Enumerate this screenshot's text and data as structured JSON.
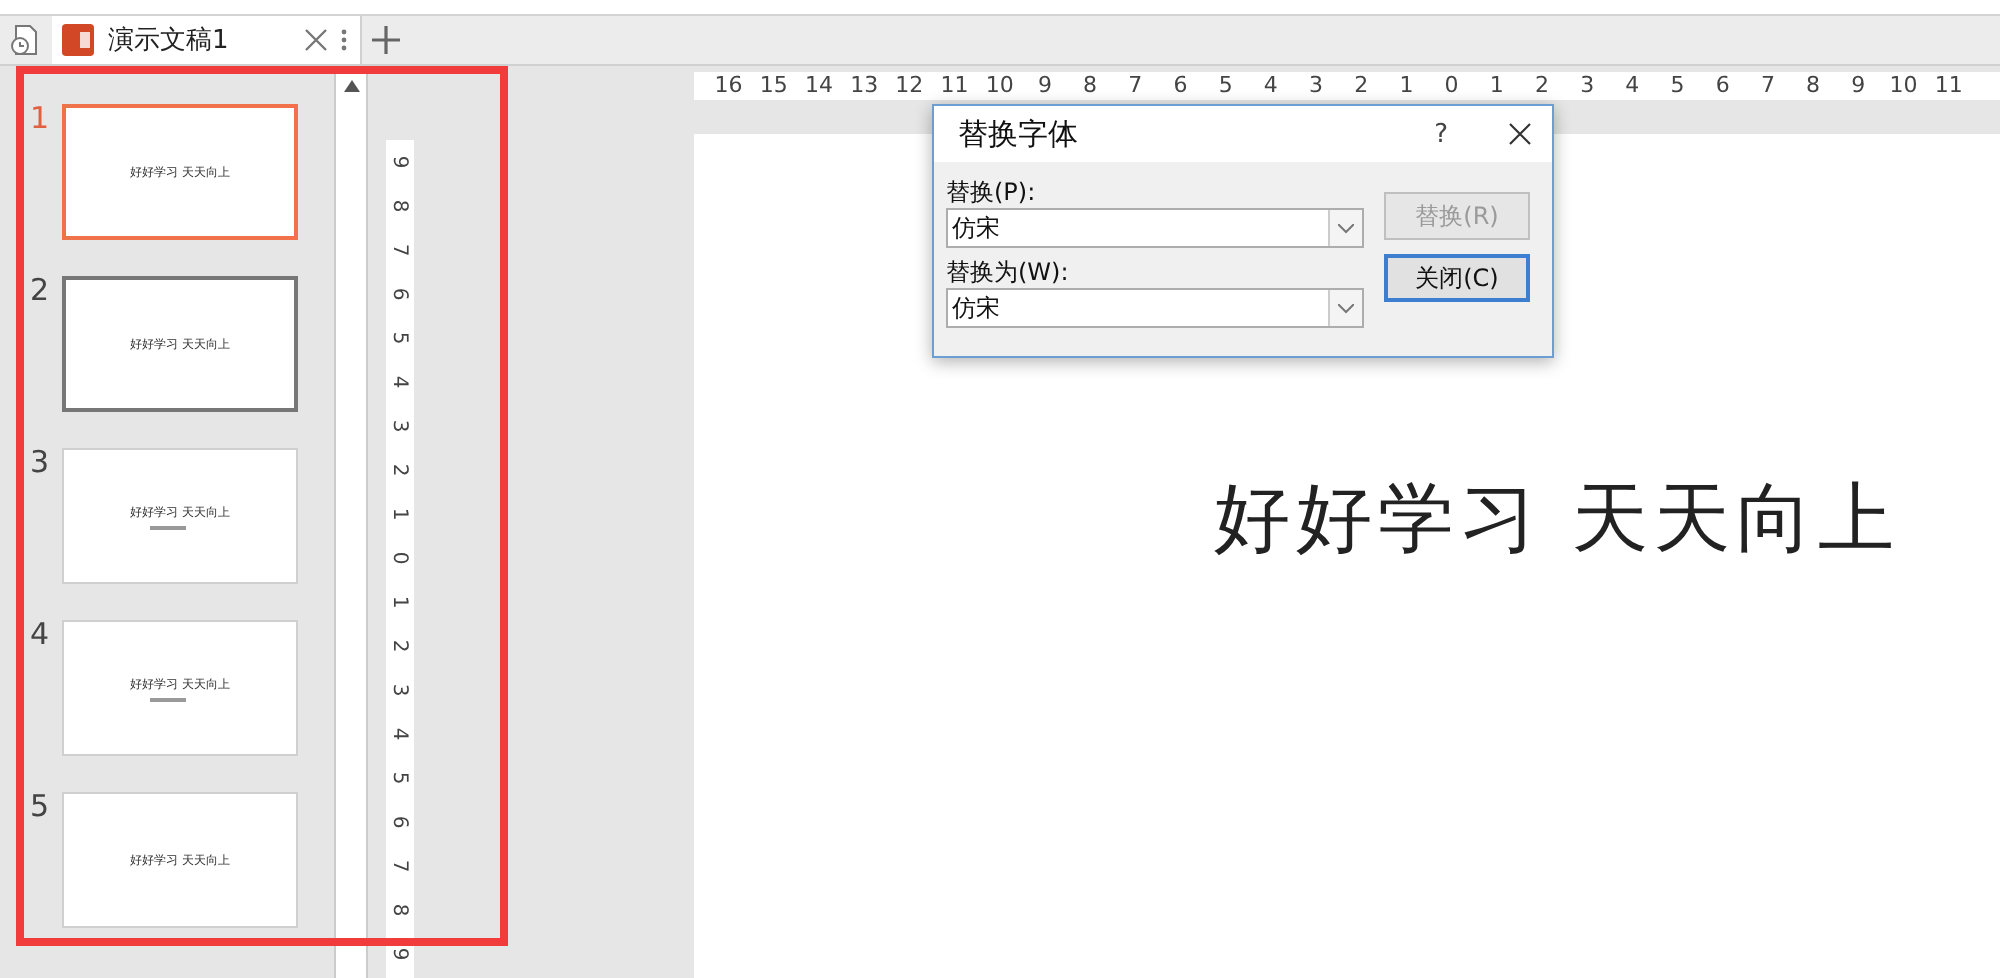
{
  "tabs": [
    {
      "label": "演示文稿1",
      "selected": true
    }
  ],
  "thumbnails": [
    {
      "number": "1",
      "title": "好好学习 天天向上",
      "subtitle": false,
      "selected": true,
      "hovered": false
    },
    {
      "number": "2",
      "title": "好好学习 天天向上",
      "subtitle": false,
      "selected": false,
      "hovered": true
    },
    {
      "number": "3",
      "title": "好好学习 天天向上",
      "subtitle": true,
      "selected": false,
      "hovered": false
    },
    {
      "number": "4",
      "title": "好好学习 天天向上",
      "subtitle": true,
      "selected": false,
      "hovered": false
    },
    {
      "number": "5",
      "title": "好好学习 天天向上",
      "subtitle": false,
      "selected": false,
      "hovered": false
    }
  ],
  "horizontal_ruler": [
    "16",
    "15",
    "14",
    "13",
    "12",
    "11",
    "10",
    "9",
    "8",
    "7",
    "6",
    "5",
    "4",
    "3",
    "2",
    "1",
    "0",
    "1",
    "2",
    "3",
    "4",
    "5",
    "6",
    "7",
    "8",
    "9",
    "10",
    "11"
  ],
  "vertical_ruler": [
    "9",
    "8",
    "7",
    "6",
    "5",
    "4",
    "3",
    "2",
    "1",
    "0",
    "1",
    "2",
    "3",
    "4",
    "5",
    "6",
    "7",
    "8",
    "9"
  ],
  "slide": {
    "title": "好好学习 天天向上"
  },
  "dialog": {
    "title": "替换字体",
    "help": "?",
    "fields": [
      {
        "label": "替换(P):",
        "value": "仿宋"
      },
      {
        "label": "替换为(W):",
        "value": "仿宋"
      }
    ],
    "buttons": [
      {
        "label": "替换(R)",
        "disabled": true,
        "default": false
      },
      {
        "label": "关闭(C)",
        "disabled": false,
        "default": true
      }
    ]
  }
}
